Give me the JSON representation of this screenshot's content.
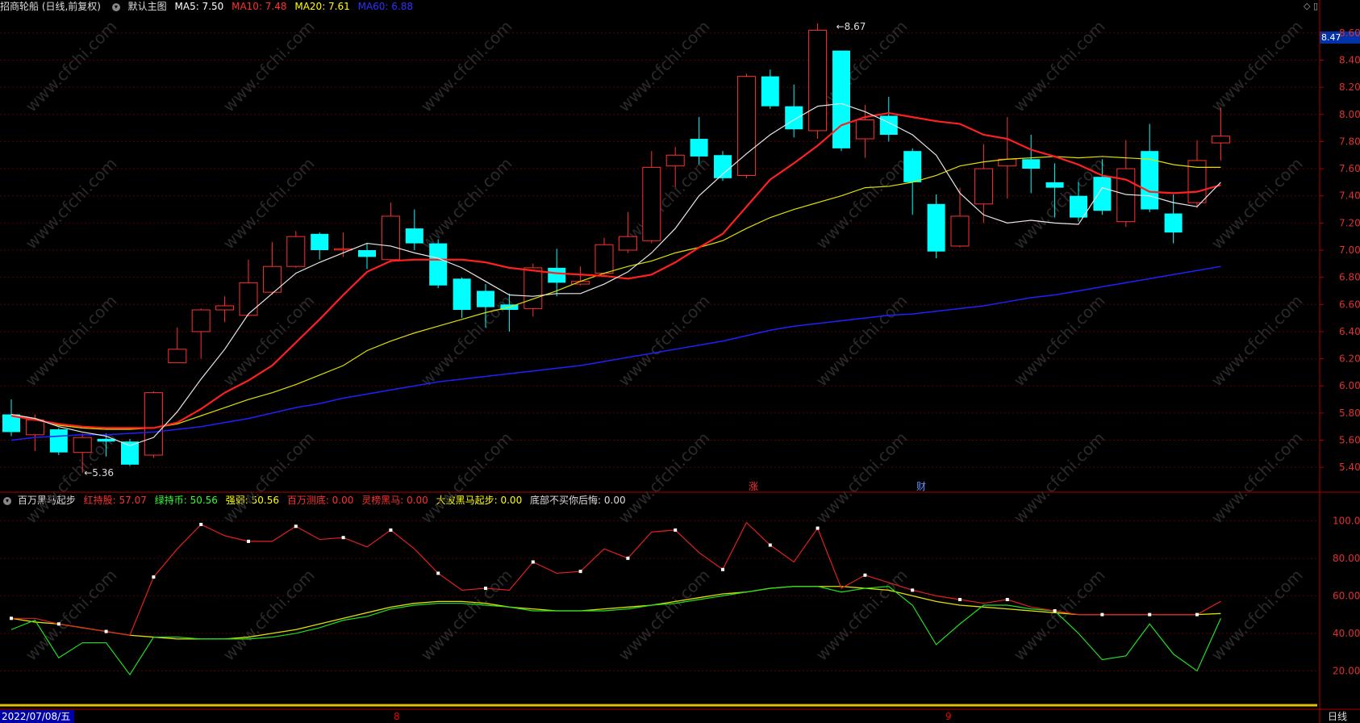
{
  "header": {
    "stock": "招商轮船 (日线,前复权)",
    "main_chart": "默认主图",
    "ma5": "MA5: 7.50",
    "ma10": "MA10: 7.48",
    "ma20": "MA20: 7.61",
    "ma60": "MA60: 6.88",
    "colors": {
      "ma5": "#ffffff",
      "ma10": "#ff2020",
      "ma20": "#ffff00",
      "ma60": "#2020ff"
    }
  },
  "window_icons": [
    "◇",
    "▯"
  ],
  "price_axis": {
    "ticks": [
      "8.60",
      "8.40",
      "8.20",
      "8.00",
      "7.80",
      "7.60",
      "7.40",
      "7.20",
      "7.00",
      "6.80",
      "6.60",
      "6.40",
      "6.20",
      "6.00",
      "5.80",
      "5.60",
      "5.40"
    ],
    "last_price": "8.47"
  },
  "annotations": {
    "high": "8.67",
    "low": "5.36",
    "zhang": "涨",
    "cai": "财"
  },
  "indicator": {
    "name": "百万黑马起步",
    "items": [
      {
        "label": "红持股: 57.07",
        "color": "#ff3030"
      },
      {
        "label": "绿持币: 50.56",
        "color": "#30ff30"
      },
      {
        "label": "强弱: 50.56",
        "color": "#ffff00"
      },
      {
        "label": "百万测底: 0.00",
        "color": "#ff3030"
      },
      {
        "label": "灵榜黑马: 0.00",
        "color": "#ff3030"
      },
      {
        "label": "大波黑马起步: 0.00",
        "color": "#ffff00"
      },
      {
        "label": "底部不买你后悔: 0.00",
        "color": "#dddddd"
      }
    ],
    "ticks": [
      "100.00",
      "80.00",
      "60.00",
      "40.00",
      "20.00"
    ]
  },
  "footer": {
    "date": "2022/07/08/五",
    "period": "日线",
    "months": [
      "8",
      "9"
    ]
  },
  "watermark": "www.cfchi.com",
  "chart_data": {
    "type": "candlestick",
    "price_range": [
      5.3,
      8.7
    ],
    "up_color": "#ff3030",
    "down_color": "#00ffff",
    "candles": [
      [
        5.79,
        5.66,
        5.9,
        5.63
      ],
      [
        5.64,
        5.75,
        5.79,
        5.52
      ],
      [
        5.68,
        5.51,
        5.69,
        5.49
      ],
      [
        5.51,
        5.62,
        5.65,
        5.36
      ],
      [
        5.61,
        5.59,
        5.65,
        5.48
      ],
      [
        5.59,
        5.42,
        5.61,
        5.41
      ],
      [
        5.49,
        5.95,
        5.96,
        5.47
      ],
      [
        6.17,
        6.27,
        6.43,
        6.17
      ],
      [
        6.4,
        6.56,
        6.57,
        6.2
      ],
      [
        6.56,
        6.59,
        6.66,
        6.47
      ],
      [
        6.52,
        6.76,
        6.93,
        6.51
      ],
      [
        6.69,
        6.88,
        7.06,
        6.67
      ],
      [
        6.88,
        7.1,
        7.14,
        6.87
      ],
      [
        7.12,
        7.0,
        7.13,
        6.93
      ],
      [
        7.01,
        7.01,
        7.13,
        6.95
      ],
      [
        7.0,
        6.95,
        7.05,
        6.86
      ],
      [
        6.93,
        7.25,
        7.35,
        6.91
      ],
      [
        7.16,
        7.05,
        7.3,
        7.0
      ],
      [
        7.05,
        6.74,
        7.08,
        6.72
      ],
      [
        6.79,
        6.56,
        6.8,
        6.5
      ],
      [
        6.7,
        6.58,
        6.75,
        6.43
      ],
      [
        6.6,
        6.56,
        6.68,
        6.4
      ],
      [
        6.57,
        6.87,
        6.9,
        6.51
      ],
      [
        6.87,
        6.76,
        7.01,
        6.66
      ],
      [
        6.75,
        6.77,
        6.88,
        6.74
      ],
      [
        6.83,
        7.04,
        7.09,
        6.81
      ],
      [
        7.0,
        7.1,
        7.28,
        6.98
      ],
      [
        7.07,
        7.61,
        7.73,
        7.05
      ],
      [
        7.62,
        7.7,
        7.76,
        7.46
      ],
      [
        7.82,
        7.69,
        7.98,
        7.63
      ],
      [
        7.7,
        7.53,
        7.73,
        7.51
      ],
      [
        7.55,
        8.28,
        8.3,
        7.53
      ],
      [
        8.28,
        8.06,
        8.33,
        8.04
      ],
      [
        8.06,
        7.89,
        8.22,
        7.83
      ],
      [
        7.88,
        8.62,
        8.67,
        7.82
      ],
      [
        8.47,
        7.75,
        8.47,
        7.73
      ],
      [
        7.82,
        7.96,
        8.07,
        7.68
      ],
      [
        7.99,
        7.85,
        8.13,
        7.8
      ],
      [
        7.73,
        7.5,
        7.75,
        7.26
      ],
      [
        7.34,
        6.99,
        7.41,
        6.94
      ],
      [
        7.03,
        7.25,
        7.46,
        7.02
      ],
      [
        7.34,
        7.6,
        7.78,
        7.2
      ],
      [
        7.62,
        7.67,
        7.98,
        7.38
      ],
      [
        7.67,
        7.6,
        7.85,
        7.42
      ],
      [
        7.5,
        7.46,
        7.64,
        7.24
      ],
      [
        7.4,
        7.24,
        7.5,
        7.21
      ],
      [
        7.54,
        7.29,
        7.67,
        7.26
      ],
      [
        7.21,
        7.6,
        7.81,
        7.17
      ],
      [
        7.73,
        7.3,
        7.93,
        7.28
      ],
      [
        7.27,
        7.13,
        7.41,
        7.05
      ],
      [
        7.35,
        7.66,
        7.81,
        7.31
      ],
      [
        7.79,
        7.84,
        8.05,
        7.66
      ]
    ],
    "ma5": [
      5.79,
      5.76,
      5.7,
      5.66,
      5.63,
      5.56,
      5.62,
      5.81,
      6.05,
      6.27,
      6.53,
      6.68,
      6.83,
      6.91,
      6.98,
      7.05,
      7.03,
      6.98,
      6.94,
      6.87,
      6.77,
      6.67,
      6.66,
      6.68,
      6.68,
      6.75,
      6.84,
      6.98,
      7.16,
      7.4,
      7.56,
      7.71,
      7.85,
      7.96,
      8.06,
      8.08,
      8.02,
      7.94,
      7.85,
      7.7,
      7.42,
      7.26,
      7.2,
      7.22,
      7.2,
      7.19,
      7.46,
      7.41,
      7.4,
      7.35,
      7.32,
      7.5
    ],
    "ma10": [
      5.78,
      5.75,
      5.72,
      5.7,
      5.69,
      5.69,
      5.69,
      5.73,
      5.83,
      5.95,
      6.04,
      6.15,
      6.32,
      6.49,
      6.67,
      6.84,
      6.92,
      6.93,
      6.93,
      6.93,
      6.91,
      6.87,
      6.85,
      6.83,
      6.82,
      6.81,
      6.79,
      6.82,
      6.91,
      7.02,
      7.12,
      7.32,
      7.52,
      7.64,
      7.77,
      7.92,
      7.98,
      8.01,
      7.98,
      7.95,
      7.93,
      7.85,
      7.82,
      7.74,
      7.69,
      7.63,
      7.55,
      7.52,
      7.43,
      7.42,
      7.43,
      7.48
    ],
    "ma20": [
      5.79,
      5.76,
      5.71,
      5.69,
      5.68,
      5.68,
      5.69,
      5.72,
      5.78,
      5.84,
      5.9,
      5.95,
      6.01,
      6.08,
      6.15,
      6.26,
      6.33,
      6.39,
      6.44,
      6.49,
      6.54,
      6.58,
      6.64,
      6.7,
      6.77,
      6.83,
      6.88,
      6.92,
      6.98,
      7.02,
      7.07,
      7.16,
      7.24,
      7.3,
      7.35,
      7.4,
      7.46,
      7.47,
      7.5,
      7.55,
      7.62,
      7.65,
      7.67,
      7.68,
      7.69,
      7.68,
      7.69,
      7.68,
      7.67,
      7.63,
      7.61,
      7.61
    ],
    "ma60": [
      5.6,
      5.62,
      5.63,
      5.64,
      5.64,
      5.65,
      5.66,
      5.68,
      5.7,
      5.73,
      5.76,
      5.8,
      5.84,
      5.87,
      5.91,
      5.94,
      5.97,
      6.0,
      6.03,
      6.05,
      6.07,
      6.09,
      6.11,
      6.13,
      6.15,
      6.18,
      6.21,
      6.24,
      6.27,
      6.3,
      6.33,
      6.37,
      6.41,
      6.44,
      6.46,
      6.48,
      6.5,
      6.52,
      6.53,
      6.55,
      6.57,
      6.59,
      6.62,
      6.65,
      6.67,
      6.7,
      6.73,
      6.76,
      6.79,
      6.82,
      6.85,
      6.88
    ],
    "indicator_range": [
      0,
      110
    ],
    "red_line": [
      48,
      48,
      45,
      43,
      41,
      39,
      70,
      85,
      98,
      92,
      89,
      89,
      97,
      90,
      91,
      86,
      95,
      85,
      72,
      63,
      64,
      63,
      78,
      72,
      73,
      85,
      80,
      94,
      95,
      83,
      74,
      99,
      87,
      78,
      96,
      64,
      71,
      67,
      63,
      60,
      58,
      56,
      58,
      54,
      52,
      50,
      50,
      50,
      50,
      50,
      50,
      57.07
    ],
    "green_line": [
      42,
      47,
      27,
      35,
      35,
      18,
      38,
      38,
      37,
      37,
      37,
      38,
      40,
      43,
      47,
      49,
      53,
      55,
      56,
      56,
      55,
      54,
      52,
      52,
      52,
      52,
      53,
      55,
      56,
      58,
      60,
      62,
      64,
      65,
      65,
      62,
      64,
      65,
      55,
      34,
      45,
      55,
      55,
      53,
      52,
      40,
      26,
      28,
      45,
      29,
      20,
      48,
      50.56
    ],
    "yellow_line": [
      48,
      46,
      45,
      43,
      41,
      39,
      38,
      37,
      37,
      37,
      38,
      40,
      42,
      45,
      48,
      51,
      54,
      56,
      57,
      57,
      56,
      54,
      53,
      52,
      52,
      53,
      54,
      55,
      57,
      59,
      61,
      62,
      64,
      65,
      65,
      65,
      64,
      63,
      60,
      57,
      55,
      54,
      53,
      52,
      51,
      50,
      50,
      50,
      50,
      50,
      50,
      50.56
    ]
  }
}
